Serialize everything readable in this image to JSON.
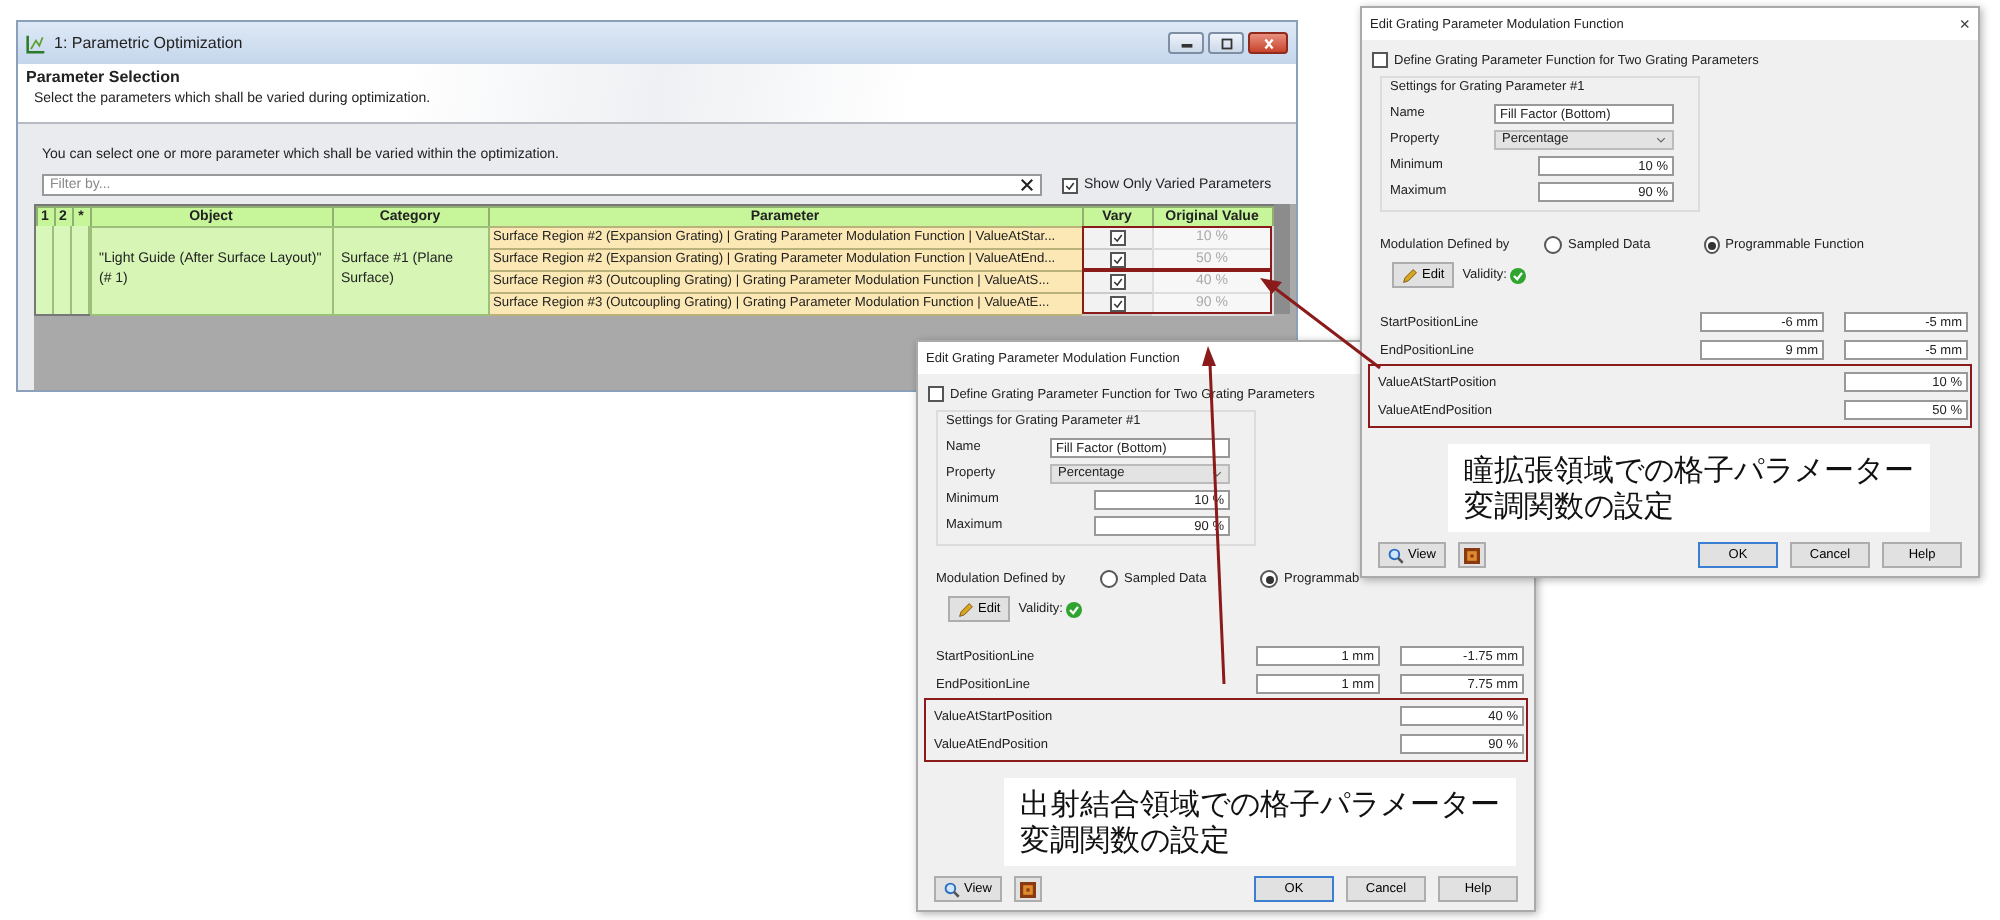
{
  "main_window": {
    "title": "1: Parametric Optimization",
    "header": {
      "title": "Parameter Selection",
      "subtitle": "Select the parameters which shall be varied during optimization."
    },
    "instructions": "You can select one or more parameter which shall be varied within the optimization.",
    "filter": {
      "placeholder": "Filter by..."
    },
    "show_only_varied": {
      "label": "Show Only Varied Parameters",
      "checked": true
    },
    "table": {
      "columns": [
        "1",
        "2",
        "*",
        "Object",
        "Category",
        "Parameter",
        "Vary",
        "Original Value"
      ],
      "object": "\"Light Guide (After Surface Layout)\" (# 1)",
      "category": "Surface #1 (Plane Surface)",
      "rows": [
        {
          "parameter": "Surface Region #2 (Expansion Grating) | Grating Parameter Modulation Function | ValueAtStar...",
          "vary": true,
          "original_value": "10 %"
        },
        {
          "parameter": "Surface Region #2 (Expansion Grating) | Grating Parameter Modulation Function | ValueAtEnd...",
          "vary": true,
          "original_value": "50 %"
        },
        {
          "parameter": "Surface Region #3 (Outcoupling Grating) | Grating Parameter Modulation Function | ValueAtS...",
          "vary": true,
          "original_value": "40 %"
        },
        {
          "parameter": "Surface Region #3 (Outcoupling Grating) | Grating Parameter Modulation Function | ValueAtE...",
          "vary": true,
          "original_value": "90 %"
        }
      ]
    }
  },
  "dialogs": [
    {
      "title": "Edit Grating Parameter Modulation Function",
      "close": "×",
      "two_params": {
        "label": "Define Grating Parameter Function for Two Grating Parameters",
        "checked": false
      },
      "group_title": "Settings for Grating Parameter #1",
      "fields": [
        {
          "label": "Name",
          "value": "Fill Factor (Bottom)",
          "kind": "text"
        },
        {
          "label": "Property",
          "value": "Percentage",
          "kind": "select"
        },
        {
          "label": "Minimum",
          "value": "10 %",
          "kind": "number"
        },
        {
          "label": "Maximum",
          "value": "90 %",
          "kind": "number"
        }
      ],
      "modulation": {
        "label": "Modulation Defined by",
        "options": [
          {
            "label": "Sampled Data",
            "selected": false
          },
          {
            "label": "Programmable Function",
            "selected": true
          }
        ]
      },
      "edit_button": "Edit",
      "validity": "Validity:",
      "positions": [
        {
          "label": "StartPositionLine",
          "values": [
            "-6 mm",
            "-5 mm"
          ]
        },
        {
          "label": "EndPositionLine",
          "values": [
            "9 mm",
            "-5 mm"
          ]
        }
      ],
      "highlighted": [
        {
          "label": "ValueAtStartPosition",
          "value": "10 %"
        },
        {
          "label": "ValueAtEndPosition",
          "value": "50 %"
        }
      ],
      "caption": [
        "瞳拡張領域での格子パラメーター",
        "変調関数の設定"
      ],
      "buttons": {
        "view": "View",
        "ok": "OK",
        "cancel": "Cancel",
        "help": "Help"
      }
    },
    {
      "title": "Edit Grating Parameter Modulation Function",
      "two_params": {
        "label": "Define Grating Parameter Function for Two Grating Parameters",
        "checked": false
      },
      "group_title": "Settings for Grating Parameter #1",
      "fields": [
        {
          "label": "Name",
          "value": "Fill Factor (Bottom)",
          "kind": "text"
        },
        {
          "label": "Property",
          "value": "Percentage",
          "kind": "select"
        },
        {
          "label": "Minimum",
          "value": "10 %",
          "kind": "number"
        },
        {
          "label": "Maximum",
          "value": "90 %",
          "kind": "number"
        }
      ],
      "modulation": {
        "label": "Modulation Defined by",
        "options": [
          {
            "label": "Sampled Data",
            "selected": false
          },
          {
            "label": "Programmab",
            "selected": true
          }
        ]
      },
      "edit_button": "Edit",
      "validity": "Validity:",
      "positions": [
        {
          "label": "StartPositionLine",
          "values": [
            "1 mm",
            "-1.75 mm"
          ]
        },
        {
          "label": "EndPositionLine",
          "values": [
            "1 mm",
            "7.75 mm"
          ]
        }
      ],
      "highlighted": [
        {
          "label": "ValueAtStartPosition",
          "value": "40 %"
        },
        {
          "label": "ValueAtEndPosition",
          "value": "90 %"
        }
      ],
      "caption": [
        "出射結合領域での格子パラメーター",
        "変調関数の設定"
      ],
      "buttons": {
        "view": "View",
        "ok": "OK",
        "cancel": "Cancel",
        "help": "Help"
      }
    }
  ]
}
